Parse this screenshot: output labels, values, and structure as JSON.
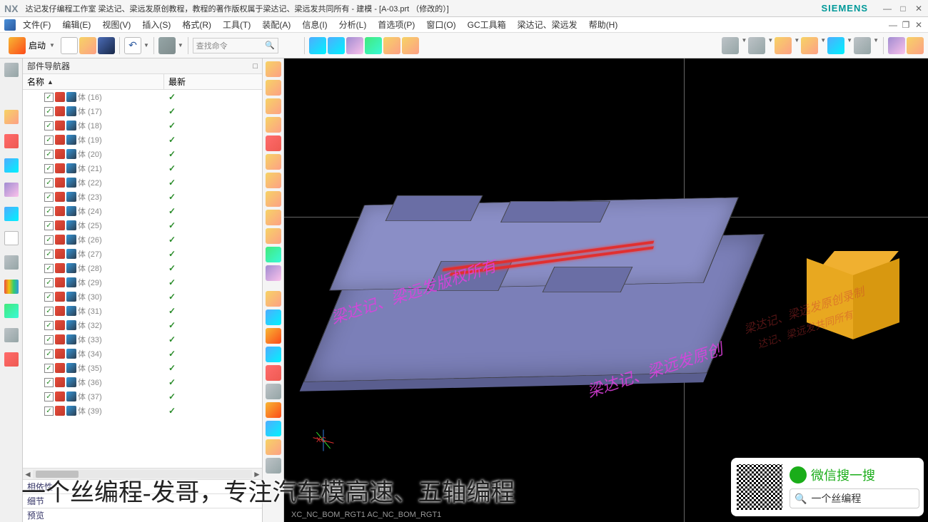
{
  "title": {
    "nx": "NX",
    "text": "达记发仔编程工作室 梁达记、梁远发原创教程，教程的著作版权属于梁达记、梁远发共同所有 - 建模 - [A-03.prt （修改的）]",
    "siemens": "SIEMENS"
  },
  "menu": {
    "items": [
      "文件(F)",
      "编辑(E)",
      "视图(V)",
      "插入(S)",
      "格式(R)",
      "工具(T)",
      "装配(A)",
      "信息(I)",
      "分析(L)",
      "首选项(P)",
      "窗口(O)",
      "GC工具箱",
      "梁达记、梁远发",
      "帮助(H)"
    ]
  },
  "toolbar": {
    "start": "启动",
    "search_placeholder": "查找命令"
  },
  "nav": {
    "title": "部件导航器",
    "col_name": "名称",
    "col_latest": "最新",
    "items": [
      {
        "label": "体 (16)",
        "check": true
      },
      {
        "label": "体 (17)",
        "check": true
      },
      {
        "label": "体 (18)",
        "check": true
      },
      {
        "label": "体 (19)",
        "check": true
      },
      {
        "label": "体 (20)",
        "check": true
      },
      {
        "label": "体 (21)",
        "check": true
      },
      {
        "label": "体 (22)",
        "check": true
      },
      {
        "label": "体 (23)",
        "check": true
      },
      {
        "label": "体 (24)",
        "check": true
      },
      {
        "label": "体 (25)",
        "check": true
      },
      {
        "label": "体 (26)",
        "check": true
      },
      {
        "label": "体 (27)",
        "check": true
      },
      {
        "label": "体 (28)",
        "check": true
      },
      {
        "label": "体 (29)",
        "check": true
      },
      {
        "label": "体 (30)",
        "check": true
      },
      {
        "label": "体 (31)",
        "check": true
      },
      {
        "label": "体 (32)",
        "check": true
      },
      {
        "label": "体 (33)",
        "check": true
      },
      {
        "label": "体 (34)",
        "check": true
      },
      {
        "label": "体 (35)",
        "check": true
      },
      {
        "label": "体 (36)",
        "check": true
      },
      {
        "label": "体 (37)",
        "check": true
      },
      {
        "label": "体 (39)",
        "check": true
      }
    ],
    "sections": [
      "相依性",
      "细节",
      "预览"
    ]
  },
  "viewport": {
    "axis_x": "XC",
    "wm1": "梁达记、梁远发版权所有",
    "wm2": "梁达记、梁远发原创",
    "wm3": "梁达记、梁远发原创录制",
    "wm4": "达记、梁远发共同所有",
    "bottom_label": "XC_NC_BOM_RGT1   AC_NC_BOM_RGT1"
  },
  "caption": "一个丝编程-发哥，专注汽车模高速、五轴编程",
  "wechat": {
    "title": "微信搜一搜",
    "search": "一个丝编程"
  }
}
